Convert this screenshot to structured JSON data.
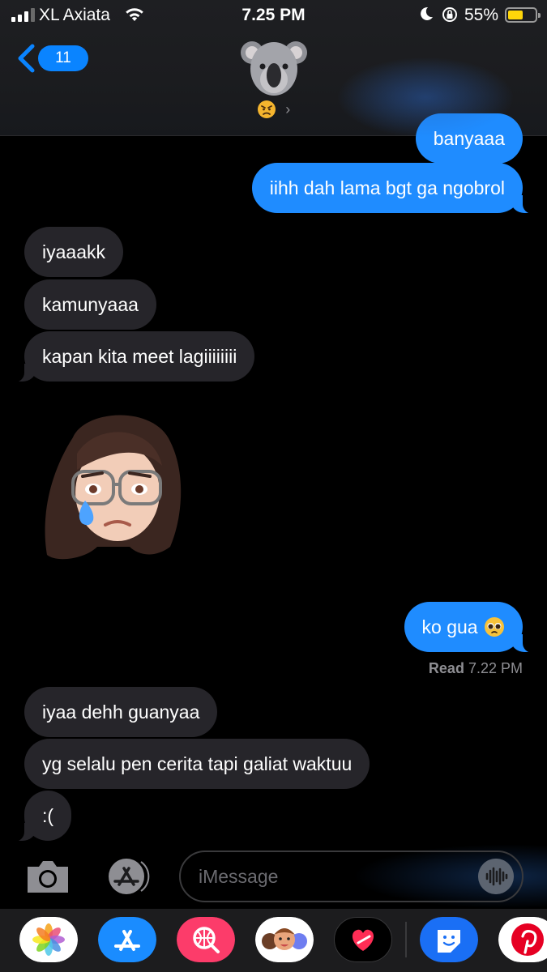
{
  "status_bar": {
    "carrier": "XL Axiata",
    "time": "7.25 PM",
    "battery_percent": "55%",
    "battery_level": 0.55,
    "signal_bars": 3
  },
  "header": {
    "back_count": "11",
    "contact_status_emoji": "angry-face-icon",
    "chevron": "›"
  },
  "messages": [
    {
      "direction": "outgoing",
      "text": "banyaaa"
    },
    {
      "direction": "outgoing",
      "text": "iihh dah lama bgt ga ngobrol"
    },
    {
      "direction": "incoming",
      "text": "iyaaakk"
    },
    {
      "direction": "incoming",
      "text": "kamunyaaa"
    },
    {
      "direction": "incoming",
      "text": "kapan kita meet lagiiiiiiii"
    },
    {
      "direction": "incoming",
      "type": "memoji-sticker",
      "icon": "crying-memoji-icon"
    },
    {
      "direction": "outgoing",
      "text": "ko gua"
    },
    {
      "direction": "incoming",
      "text": "iyaa dehh guanyaa"
    },
    {
      "direction": "incoming",
      "text": "yg selalu pen cerita tapi galiat waktuu"
    },
    {
      "direction": "incoming",
      "text": ":("
    }
  ],
  "receipt": {
    "label": "Read",
    "time": "7.22 PM"
  },
  "composer": {
    "placeholder": "iMessage"
  },
  "app_drawer": [
    {
      "name": "Photos",
      "icon": "photos-icon"
    },
    {
      "name": "App Store",
      "icon": "app-store-icon"
    },
    {
      "name": "Images",
      "icon": "image-search-icon"
    },
    {
      "name": "Memoji",
      "icon": "memoji-stickers-icon"
    },
    {
      "name": "Digital Touch",
      "icon": "digital-touch-icon"
    },
    {
      "name": "Sticker",
      "icon": "sticker-icon"
    },
    {
      "name": "Pinterest",
      "icon": "pinterest-icon"
    }
  ],
  "colors": {
    "outgoing_bubble": "#1f8cff",
    "incoming_bubble": "#26252a",
    "accent": "#0a84ff",
    "background": "#000000"
  }
}
